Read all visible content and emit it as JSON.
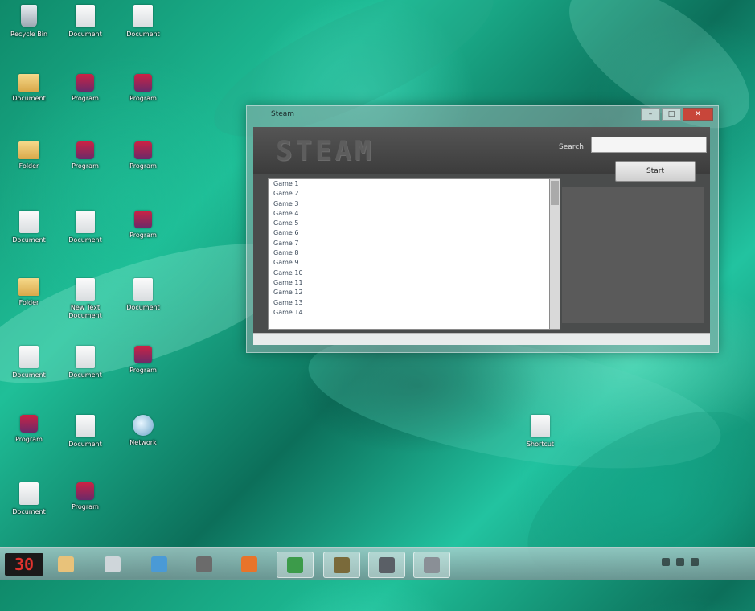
{
  "desktop": {
    "icons": [
      {
        "label": "Recycle Bin",
        "kind": "bin"
      },
      {
        "label": "Document",
        "kind": "file"
      },
      {
        "label": "Document",
        "kind": "file"
      },
      {
        "label": "Document",
        "kind": "folder"
      },
      {
        "label": "Program",
        "kind": "app"
      },
      {
        "label": "Program",
        "kind": "app"
      },
      {
        "label": "Folder",
        "kind": "folder"
      },
      {
        "label": "Program",
        "kind": "app"
      },
      {
        "label": "Program",
        "kind": "app"
      },
      {
        "label": "Document",
        "kind": "file"
      },
      {
        "label": "Document",
        "kind": "file"
      },
      {
        "label": "Program",
        "kind": "app"
      },
      {
        "label": "Folder",
        "kind": "folder"
      },
      {
        "label": "New Text Document",
        "kind": "file"
      },
      {
        "label": "Document",
        "kind": "file"
      },
      {
        "label": "Document",
        "kind": "file"
      },
      {
        "label": "Document",
        "kind": "file"
      },
      {
        "label": "Program",
        "kind": "app"
      },
      {
        "label": "Program",
        "kind": "app"
      },
      {
        "label": "Document",
        "kind": "file"
      },
      {
        "label": "Network",
        "kind": "globe"
      },
      {
        "label": "Document",
        "kind": "file"
      },
      {
        "label": "Program",
        "kind": "app"
      },
      {
        "label": "Shortcut",
        "kind": "file"
      }
    ]
  },
  "window": {
    "title": "Steam",
    "logo": "STEAM",
    "search_label": "Search",
    "search_value": "",
    "action_button": "Start",
    "games": [
      "Game 1",
      "Game 2",
      "Game 3",
      "Game 4",
      "Game 5",
      "Game 6",
      "Game 7",
      "Game 8",
      "Game 9",
      "Game 10",
      "Game 11",
      "Game 12",
      "Game 13",
      "Game 14"
    ],
    "pane_note": "",
    "controls": {
      "minimize": "–",
      "maximize": "□",
      "close": "✕"
    }
  },
  "taskbar": {
    "start_label": "30",
    "buttons": [
      {
        "icon": "explorer-icon",
        "color": "#e8c27a"
      },
      {
        "icon": "control-panel-icon",
        "color": "#cfd6da"
      },
      {
        "icon": "media-player-icon",
        "color": "#4a9ad6"
      },
      {
        "icon": "image-viewer-icon",
        "color": "#6b6b6b"
      },
      {
        "icon": "firefox-icon",
        "color": "#e8742a"
      },
      {
        "icon": "chrome-icon",
        "color": "#3c9b4a"
      },
      {
        "icon": "media-icon",
        "color": "#7a6a3a"
      },
      {
        "icon": "steam-icon",
        "color": "#5a5f66"
      },
      {
        "icon": "app-icon",
        "color": "#8a8f96"
      }
    ],
    "clock_time": "",
    "clock_date": ""
  }
}
